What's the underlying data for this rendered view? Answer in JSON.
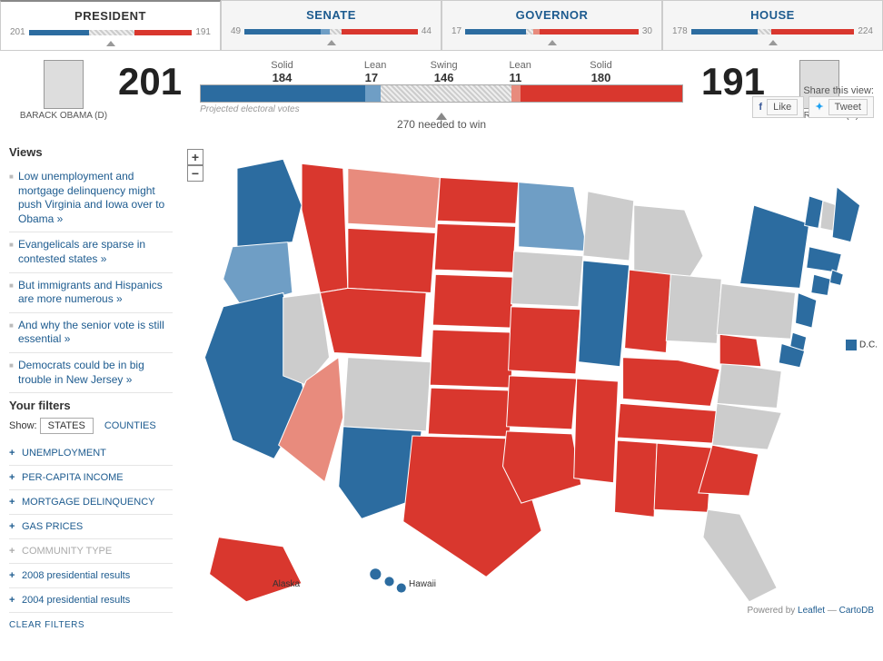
{
  "tabs": {
    "president": {
      "label": "PRESIDENT",
      "left": "201",
      "mid": "146",
      "right": "191"
    },
    "senate": {
      "label": "SENATE",
      "left": "49",
      "mid": "7",
      "right": "44"
    },
    "governor": {
      "label": "GOVERNOR",
      "left": "17",
      "mid": "2",
      "right": "30"
    },
    "house": {
      "label": "HOUSE",
      "left": "178",
      "mid": "33",
      "right": "224"
    }
  },
  "candidates": {
    "left": {
      "name": "BARACK OBAMA (D)",
      "total": "201"
    },
    "right": {
      "name": "MITT ROMNEY (R)",
      "total": "191"
    }
  },
  "bar": {
    "segments": [
      {
        "label": "Solid",
        "value": "184"
      },
      {
        "label": "Lean",
        "value": "17"
      },
      {
        "label": "Swing",
        "value": "146"
      },
      {
        "label": "Lean",
        "value": "11"
      },
      {
        "label": "Solid",
        "value": "180"
      }
    ],
    "projected": "Projected electoral votes",
    "needed": "270 needed to win"
  },
  "views": {
    "heading": "Views",
    "items": [
      "Low unemployment and mortgage delinquency might push Virginia and Iowa over to Obama »",
      "Evangelicals are sparse in contested states »",
      "But immigrants and Hispanics are more numerous »",
      "And why the senior vote is still essential »",
      "Democrats could be in big trouble in New Jersey »"
    ]
  },
  "filters": {
    "heading": "Your filters",
    "show_label": "Show:",
    "show_states": "STATES",
    "show_counties": "COUNTIES",
    "items": [
      {
        "label": "UNEMPLOYMENT",
        "enabled": true
      },
      {
        "label": "PER-CAPITA INCOME",
        "enabled": true
      },
      {
        "label": "MORTGAGE DELINQUENCY",
        "enabled": true
      },
      {
        "label": "GAS PRICES",
        "enabled": true
      },
      {
        "label": "COMMUNITY TYPE",
        "enabled": false
      },
      {
        "label": "2008 presidential results",
        "enabled": true
      },
      {
        "label": "2004 presidential results",
        "enabled": true
      }
    ],
    "clear": "CLEAR FILTERS"
  },
  "share": {
    "heading": "Share this view:",
    "like": "Like",
    "tweet": "Tweet"
  },
  "map": {
    "dc": "D.C.",
    "alaska": "Alaska",
    "hawaii": "Hawaii",
    "attrib_prefix": "Powered by ",
    "leaflet": "Leaflet",
    "sep": " — ",
    "cartodb": "CartoDB"
  },
  "chart_data": {
    "type": "map",
    "title": "Projected electoral votes",
    "legend": {
      "Solid D": "#2c6ca0",
      "Lean D": "#6f9ec5",
      "Swing": "#cccccc",
      "Lean R": "#e88b7d",
      "Solid R": "#d9372e"
    },
    "totals": {
      "Obama": 201,
      "Romney": 191,
      "Swing": 146,
      "needed_to_win": 270
    },
    "segments": {
      "Solid D": 184,
      "Lean D": 17,
      "Swing": 146,
      "Lean R": 11,
      "Solid R": 180
    },
    "states": {
      "WA": "Solid D",
      "OR": "Lean D",
      "CA": "Solid D",
      "NV": "Swing",
      "ID": "Solid R",
      "MT": "Lean R",
      "WY": "Solid R",
      "UT": "Solid R",
      "AZ": "Lean R",
      "CO": "Swing",
      "NM": "Solid D",
      "ND": "Solid R",
      "SD": "Solid R",
      "NE": "Solid R",
      "KS": "Solid R",
      "OK": "Solid R",
      "TX": "Solid R",
      "MN": "Lean D",
      "IA": "Swing",
      "MO": "Solid R",
      "AR": "Solid R",
      "LA": "Solid R",
      "WI": "Swing",
      "IL": "Solid D",
      "MI": "Swing",
      "IN": "Solid R",
      "OH": "Swing",
      "KY": "Solid R",
      "TN": "Solid R",
      "MS": "Solid R",
      "AL": "Solid R",
      "GA": "Solid R",
      "FL": "Swing",
      "SC": "Solid R",
      "NC": "Swing",
      "VA": "Swing",
      "WV": "Solid R",
      "PA": "Swing",
      "NY": "Solid D",
      "VT": "Solid D",
      "NH": "Swing",
      "ME": "Solid D",
      "MA": "Solid D",
      "RI": "Solid D",
      "CT": "Solid D",
      "NJ": "Solid D",
      "DE": "Solid D",
      "MD": "Solid D",
      "DC": "Solid D",
      "AK": "Solid R",
      "HI": "Solid D"
    },
    "other_tabs": {
      "senate": {
        "D": 49,
        "swing": 7,
        "R": 44
      },
      "governor": {
        "D": 17,
        "swing": 2,
        "R": 30
      },
      "house": {
        "D": 178,
        "swing": 33,
        "R": 224
      }
    }
  }
}
